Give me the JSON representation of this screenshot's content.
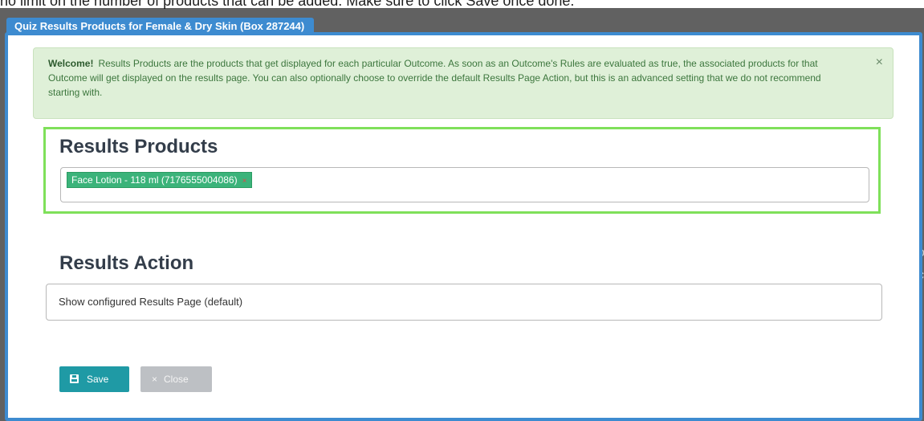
{
  "background": {
    "partial_text": "no limit on the number of products that can be added. Make sure to click Save once done.",
    "edge_glyph_1": "o",
    "edge_glyph_2": "c"
  },
  "modal": {
    "title": "Quiz Results Products for Female & Dry Skin (Box 287244)",
    "accent_color": "#3d8bd0"
  },
  "alert": {
    "lead": "Welcome!",
    "text": "Results Products are the products that get displayed for each particular Outcome. As soon as an Outcome's Rules are evaluated as true, the associated products for that Outcome will get displayed on the results page. You can also optionally choose to override the default Results Page Action, but this is an advanced setting that we do not recommend starting with.",
    "close_icon": "×"
  },
  "results_products": {
    "title": "Results Products",
    "selected_tags": [
      {
        "label": "Face Lotion - 118 ml (7176555004086)",
        "remove_icon": "×"
      }
    ],
    "highlight_color": "#7fe05a"
  },
  "results_action": {
    "title": "Results Action",
    "selected_value": "Show configured Results Page (default)"
  },
  "buttons": {
    "save_label": "Save",
    "save_icon": "save-icon",
    "close_label": "Close",
    "close_icon": "×"
  }
}
